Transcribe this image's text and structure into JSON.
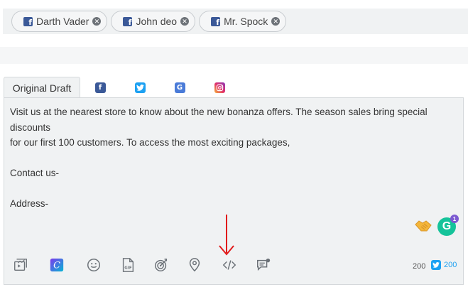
{
  "accounts": [
    {
      "name": "Darth Vader",
      "network": "facebook"
    },
    {
      "name": "John deo",
      "network": "facebook"
    },
    {
      "name": "Mr. Spock",
      "network": "facebook"
    }
  ],
  "tabs": {
    "original_draft": "Original Draft",
    "networks": [
      "facebook",
      "twitter",
      "google-my-business",
      "instagram"
    ]
  },
  "draft": {
    "line1": "Visit us at the nearest store to know about the new bonanza offers. The season sales bring special discounts",
    "line2": "for our first 100 customers. To access the most exciting packages,",
    "line3": "Contact us-",
    "line4": "Address-"
  },
  "grammarly": {
    "badge_count": "1"
  },
  "counters": {
    "main": "200",
    "twitter": "200"
  },
  "toolbar_icons": [
    "media-icon",
    "canva-icon",
    "emoji-icon",
    "gif-icon",
    "target-icon",
    "location-icon",
    "code-icon",
    "comment-icon"
  ],
  "colors": {
    "facebook": "#3b5998",
    "twitter": "#1da1f2",
    "grammarly": "#15c39a",
    "arrow": "#e11a1a"
  }
}
